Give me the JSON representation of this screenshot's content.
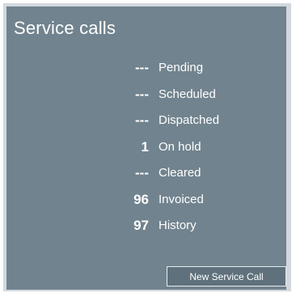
{
  "widget": {
    "title": "Service calls",
    "rows": [
      {
        "count": "---",
        "label": "Pending"
      },
      {
        "count": "---",
        "label": "Scheduled"
      },
      {
        "count": "---",
        "label": "Dispatched"
      },
      {
        "count": "1",
        "label": "On hold"
      },
      {
        "count": "---",
        "label": "Cleared"
      },
      {
        "count": "96",
        "label": "Invoiced"
      },
      {
        "count": "97",
        "label": "History"
      }
    ],
    "new_button_label": "New Service Call"
  },
  "colors": {
    "panel_background": "#71838e",
    "frame_border": "#d2d8dd",
    "text": "#ffffff"
  }
}
